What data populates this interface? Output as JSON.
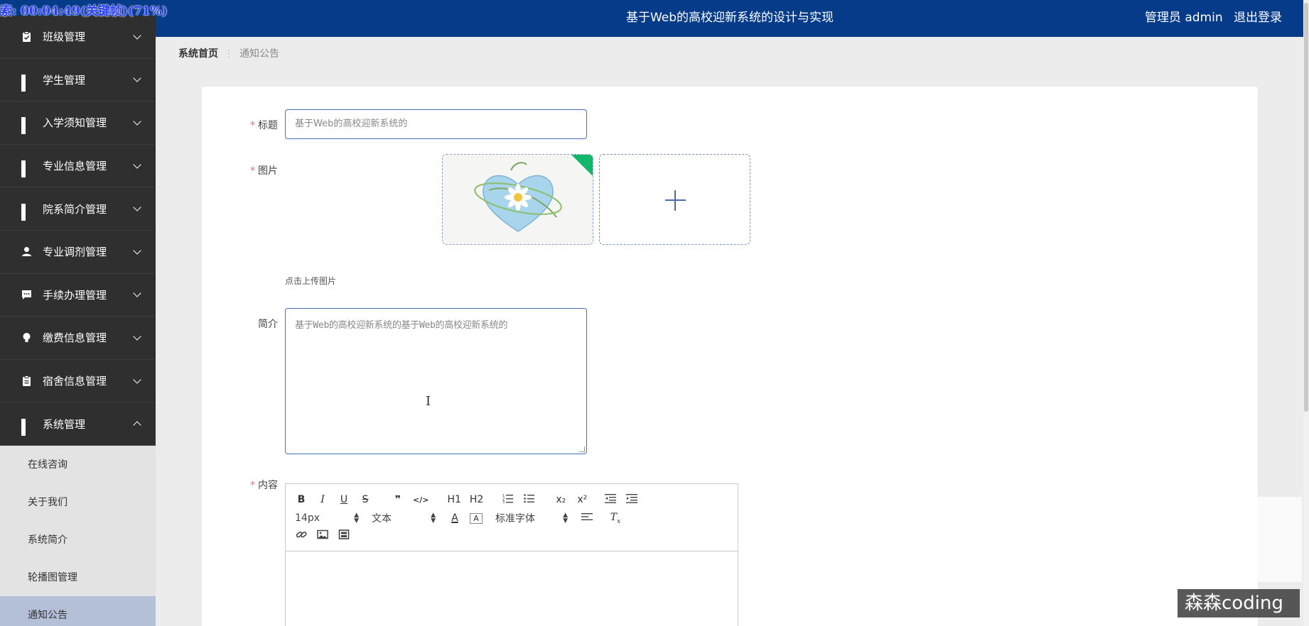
{
  "overlay": {
    "time_text": "索: 00:04:49(关键帧)(71%)"
  },
  "header": {
    "title": "基于Web的高校迎新系统的设计与实现",
    "user_label": "管理员 admin",
    "logout_label": "退出登录"
  },
  "sidebar": {
    "items": [
      {
        "label": "班级管理",
        "icon": "clipboard-check-icon"
      },
      {
        "label": "学生管理",
        "icon": "grid-icon"
      },
      {
        "label": "入学须知管理",
        "icon": "grid-icon"
      },
      {
        "label": "专业信息管理",
        "icon": "grid-icon"
      },
      {
        "label": "院系简介管理",
        "icon": "grid-icon"
      },
      {
        "label": "专业调剂管理",
        "icon": "user-icon"
      },
      {
        "label": "手续办理管理",
        "icon": "chat-icon"
      },
      {
        "label": "缴费信息管理",
        "icon": "bulb-icon"
      },
      {
        "label": "宿舍信息管理",
        "icon": "clipboard-icon"
      },
      {
        "label": "系统管理",
        "icon": "grid-icon"
      }
    ],
    "submenu": [
      {
        "label": "在线咨询"
      },
      {
        "label": "关于我们"
      },
      {
        "label": "系统简介"
      },
      {
        "label": "轮播图管理"
      },
      {
        "label": "通知公告"
      }
    ]
  },
  "breadcrumb": {
    "home": "系统首页",
    "separator": "⋮",
    "current": "通知公告"
  },
  "form": {
    "title_label": "标题",
    "title_value": "基于Web的高校迎新系统的",
    "image_label": "图片",
    "upload_tip": "点击上传图片",
    "intro_label": "简介",
    "intro_value": "基于Web的高校迎新系统的基于Web的高校迎新系统的",
    "content_label": "内容",
    "required_mark": "*"
  },
  "editor": {
    "font_size": "14px",
    "text_type": "文本",
    "font_family": "标准字体",
    "buttons_row1": [
      "B",
      "I",
      "U",
      "S",
      "❞",
      "</>",
      "H1",
      "H2",
      "ol",
      "ul",
      "x₂",
      "x²",
      "outdent",
      "indent"
    ]
  },
  "watermark": {
    "text": "森森coding"
  }
}
